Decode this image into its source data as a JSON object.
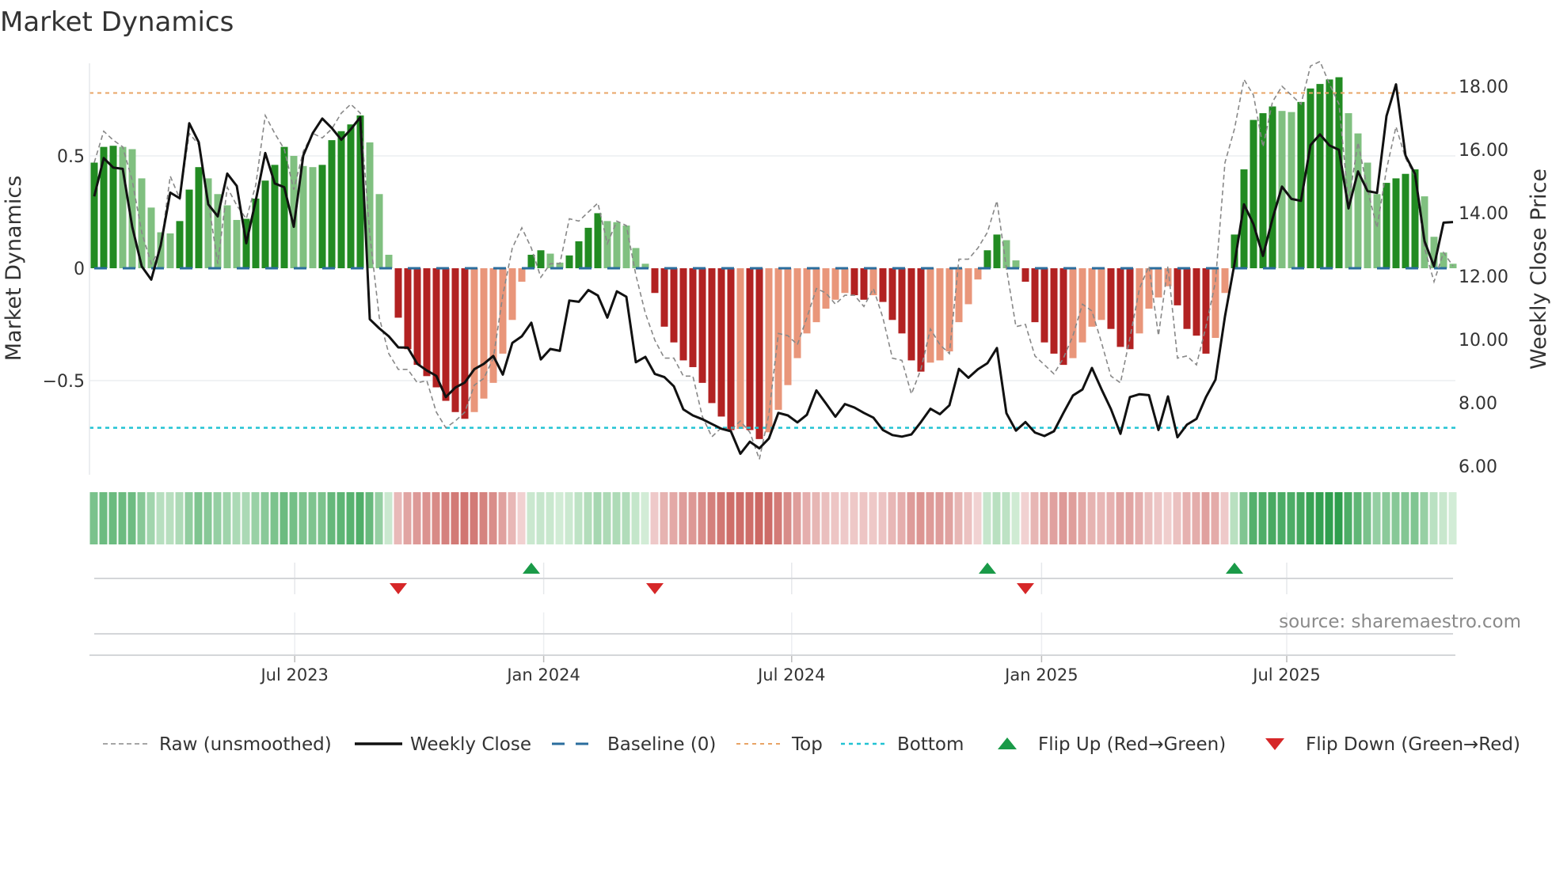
{
  "chart_data": {
    "type": "bar",
    "title": "Market Dynamics",
    "ylabel_left": "Market Dynamics",
    "ylabel_right": "Weekly Close Price",
    "ylim_left": [
      -0.92,
      0.91
    ],
    "ylim_right": [
      5.73,
      18.73
    ],
    "yticks_left": [
      {
        "value": 0.5,
        "label": "0.5"
      },
      {
        "value": 0,
        "label": "0"
      },
      {
        "value": -0.5,
        "label": "−0.5"
      }
    ],
    "yticks_right": [
      {
        "value": 18,
        "label": "18.00"
      },
      {
        "value": 16,
        "label": "16.00"
      },
      {
        "value": 14,
        "label": "14.00"
      },
      {
        "value": 12,
        "label": "12.00"
      },
      {
        "value": 10,
        "label": "10.00"
      },
      {
        "value": 8,
        "label": "8.00"
      },
      {
        "value": 6,
        "label": "6.00"
      }
    ],
    "xticks": [
      {
        "week": 21.1,
        "label": "Jul 2023"
      },
      {
        "week": 47.3,
        "label": "Jan 2024"
      },
      {
        "week": 73.4,
        "label": "Jul 2024"
      },
      {
        "week": 99.7,
        "label": "Jan 2025"
      },
      {
        "week": 125.5,
        "label": "Jul 2025"
      }
    ],
    "levels": {
      "top": 0.78,
      "bottom": -0.71,
      "baseline": 0
    },
    "colors": {
      "green_dark": "#228b22",
      "green_light": "#80c080",
      "red_dark": "#b22222",
      "red_light": "#e9967a",
      "raw": "#888888",
      "close": "#111111",
      "baseline": "#2b6e9e",
      "top": "#e8a466",
      "bottom": "#22c3d3",
      "flip_up": "#1a9a48",
      "flip_down": "#d62728"
    },
    "dynamics": [
      0.47,
      0.54,
      0.545,
      0.54,
      0.53,
      0.4,
      0.27,
      0.16,
      0.155,
      0.21,
      0.35,
      0.45,
      0.4,
      0.33,
      0.28,
      0.215,
      0.22,
      0.31,
      0.39,
      0.46,
      0.54,
      0.5,
      0.455,
      0.45,
      0.46,
      0.57,
      0.61,
      0.64,
      0.68,
      0.56,
      0.33,
      0.06,
      -0.22,
      -0.36,
      -0.43,
      -0.48,
      -0.53,
      -0.59,
      -0.64,
      -0.67,
      -0.64,
      -0.58,
      -0.51,
      -0.38,
      -0.23,
      -0.06,
      0.06,
      0.08,
      0.065,
      0.025,
      0.057,
      0.12,
      0.18,
      0.245,
      0.21,
      0.205,
      0.19,
      0.09,
      0.02,
      -0.11,
      -0.26,
      -0.33,
      -0.41,
      -0.44,
      -0.51,
      -0.6,
      -0.66,
      -0.72,
      -0.715,
      -0.72,
      -0.76,
      -0.73,
      -0.63,
      -0.52,
      -0.4,
      -0.29,
      -0.24,
      -0.18,
      -0.14,
      -0.11,
      -0.12,
      -0.14,
      -0.12,
      -0.15,
      -0.23,
      -0.29,
      -0.41,
      -0.46,
      -0.42,
      -0.41,
      -0.37,
      -0.24,
      -0.16,
      -0.05,
      0.08,
      0.15,
      0.125,
      0.035,
      -0.06,
      -0.24,
      -0.33,
      -0.38,
      -0.43,
      -0.4,
      -0.33,
      -0.26,
      -0.23,
      -0.27,
      -0.35,
      -0.36,
      -0.29,
      -0.18,
      -0.13,
      -0.08,
      -0.165,
      -0.27,
      -0.3,
      -0.38,
      -0.31,
      -0.11,
      0.15,
      0.44,
      0.66,
      0.69,
      0.72,
      0.7,
      0.695,
      0.74,
      0.8,
      0.82,
      0.84,
      0.85,
      0.69,
      0.6,
      0.47,
      0.33,
      0.38,
      0.4,
      0.42,
      0.44,
      0.32,
      0.14,
      0.07,
      0.02
    ],
    "raw": [
      0.47,
      0.61,
      0.57,
      0.54,
      0.39,
      0.16,
      0.02,
      0.09,
      0.41,
      0.31,
      0.6,
      0.55,
      0.3,
      0.02,
      0.36,
      0.28,
      0.22,
      0.37,
      0.68,
      0.6,
      0.53,
      0.35,
      0.52,
      0.6,
      0.58,
      0.62,
      0.69,
      0.73,
      0.69,
      0.15,
      -0.22,
      -0.38,
      -0.45,
      -0.45,
      -0.51,
      -0.5,
      -0.64,
      -0.71,
      -0.68,
      -0.64,
      -0.52,
      -0.49,
      -0.4,
      -0.12,
      0.09,
      0.18,
      0.09,
      -0.04,
      0.02,
      0.02,
      0.22,
      0.21,
      0.25,
      0.29,
      0.11,
      0.21,
      0.19,
      -0.03,
      -0.2,
      -0.32,
      -0.4,
      -0.4,
      -0.48,
      -0.48,
      -0.66,
      -0.75,
      -0.71,
      -0.72,
      -0.68,
      -0.73,
      -0.85,
      -0.65,
      -0.29,
      -0.3,
      -0.34,
      -0.22,
      -0.09,
      -0.11,
      -0.16,
      -0.12,
      -0.12,
      -0.17,
      -0.09,
      -0.22,
      -0.4,
      -0.41,
      -0.56,
      -0.45,
      -0.27,
      -0.34,
      -0.38,
      0.04,
      0.04,
      0.09,
      0.16,
      0.3,
      0.0,
      -0.26,
      -0.25,
      -0.39,
      -0.43,
      -0.47,
      -0.4,
      -0.3,
      -0.16,
      -0.19,
      -0.33,
      -0.48,
      -0.51,
      -0.31,
      -0.09,
      0.01,
      -0.3,
      0.01,
      -0.4,
      -0.39,
      -0.43,
      -0.26,
      -0.06,
      0.47,
      0.62,
      0.84,
      0.77,
      0.54,
      0.74,
      0.81,
      0.77,
      0.73,
      0.9,
      0.92,
      0.82,
      0.73,
      0.29,
      0.56,
      0.35,
      0.18,
      0.44,
      0.63,
      0.49,
      0.41,
      0.09,
      -0.06,
      0.07,
      0.01
    ],
    "close": [
      14.52,
      15.73,
      15.43,
      15.39,
      13.56,
      12.31,
      11.89,
      12.98,
      14.64,
      14.46,
      16.83,
      16.23,
      14.27,
      13.89,
      15.24,
      14.85,
      13.04,
      14.39,
      15.89,
      14.93,
      14.81,
      13.56,
      15.81,
      16.52,
      16.98,
      16.68,
      16.31,
      16.64,
      17.02,
      10.64,
      10.35,
      10.1,
      9.75,
      9.74,
      9.23,
      9.02,
      8.85,
      8.18,
      8.48,
      8.64,
      9.06,
      9.23,
      9.48,
      8.89,
      9.89,
      10.1,
      10.53,
      9.37,
      9.7,
      9.64,
      11.23,
      11.19,
      11.56,
      11.39,
      10.69,
      11.52,
      11.35,
      9.28,
      9.45,
      8.91,
      8.81,
      8.52,
      7.79,
      7.6,
      7.48,
      7.33,
      7.18,
      7.1,
      6.39,
      6.77,
      6.56,
      6.87,
      7.68,
      7.6,
      7.38,
      7.62,
      8.39,
      7.98,
      7.56,
      7.96,
      7.85,
      7.68,
      7.53,
      7.14,
      6.98,
      6.93,
      7.0,
      7.39,
      7.81,
      7.64,
      7.92,
      9.07,
      8.79,
      9.06,
      9.25,
      9.73,
      7.67,
      7.12,
      7.39,
      7.06,
      6.95,
      7.1,
      7.68,
      8.23,
      8.42,
      9.1,
      8.43,
      7.8,
      7.02,
      8.18,
      8.27,
      8.24,
      7.14,
      8.2,
      6.91,
      7.31,
      7.49,
      8.18,
      8.73,
      10.73,
      12.39,
      14.27,
      13.64,
      12.64,
      13.81,
      14.83,
      14.44,
      14.38,
      16.14,
      16.48,
      16.13,
      15.99,
      14.14,
      15.31,
      14.69,
      14.63,
      17.06,
      18.06,
      15.81,
      15.23,
      13.11,
      12.31,
      13.69,
      13.71
    ],
    "legend": {
      "placement": "bottom",
      "entries": [
        {
          "key": "raw",
          "label": "Raw (unsmoothed)"
        },
        {
          "key": "close",
          "label": "Weekly Close"
        },
        {
          "key": "baseline",
          "label": "Baseline (0)"
        },
        {
          "key": "top",
          "label": "Top"
        },
        {
          "key": "bottom",
          "label": "Bottom"
        },
        {
          "key": "flip_up",
          "label": "Flip Up (Red→Green)"
        },
        {
          "key": "flip_down",
          "label": "Flip Down (Green→Red)"
        }
      ]
    },
    "source": "source: sharemaestro.com"
  }
}
